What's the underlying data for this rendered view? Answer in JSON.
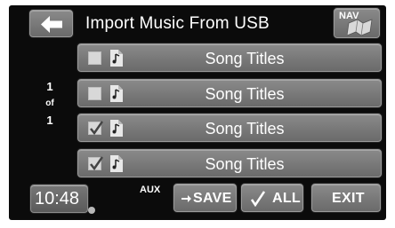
{
  "header": {
    "back_icon": "left-arrow-icon",
    "title": "Import Music From USB",
    "nav_label": "NAV",
    "nav_icon": "map-icon"
  },
  "songs": [
    {
      "title": "Song Titles",
      "checked": false
    },
    {
      "title": "Song Titles",
      "checked": false
    },
    {
      "title": "Song Titles",
      "checked": true
    },
    {
      "title": "Song Titles",
      "checked": true
    }
  ],
  "pager": {
    "current": "1",
    "of": "of",
    "total": "1"
  },
  "footer": {
    "time": "10:48",
    "source": "AUX",
    "save_label": "SAVE",
    "save_icon": "arrow-right-icon",
    "all_label": "ALL",
    "all_icon": "check-icon",
    "exit_label": "EXIT"
  }
}
